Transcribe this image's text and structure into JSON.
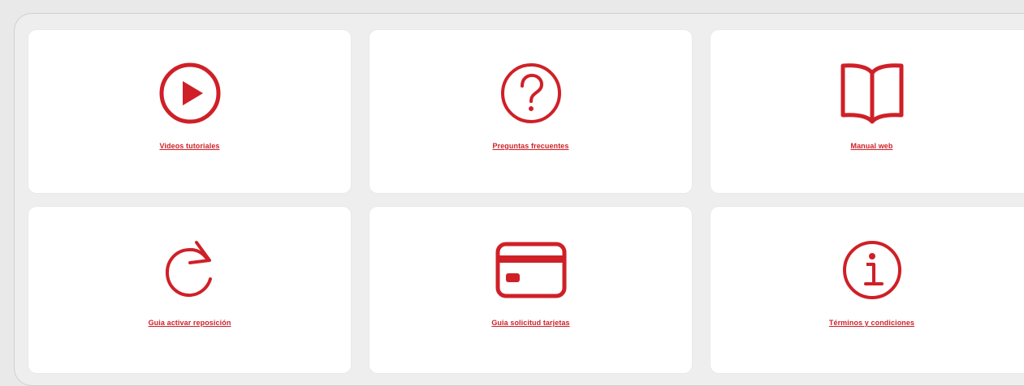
{
  "colors": {
    "accent": "#cf2027",
    "card_bg": "#ffffff",
    "page_bg": "#eeeeee"
  },
  "cards": [
    {
      "label": "Videos tutoriales",
      "icon": "play-circle-icon"
    },
    {
      "label": "Preguntas frecuentes",
      "icon": "question-circle-icon"
    },
    {
      "label": "Manual web",
      "icon": "open-book-icon"
    },
    {
      "label": "Guia activar reposición",
      "icon": "refresh-arrow-icon"
    },
    {
      "label": "Guia solicitud tarjetas",
      "icon": "credit-card-icon"
    },
    {
      "label": "Términos y condiciones",
      "icon": "info-circle-icon"
    }
  ]
}
